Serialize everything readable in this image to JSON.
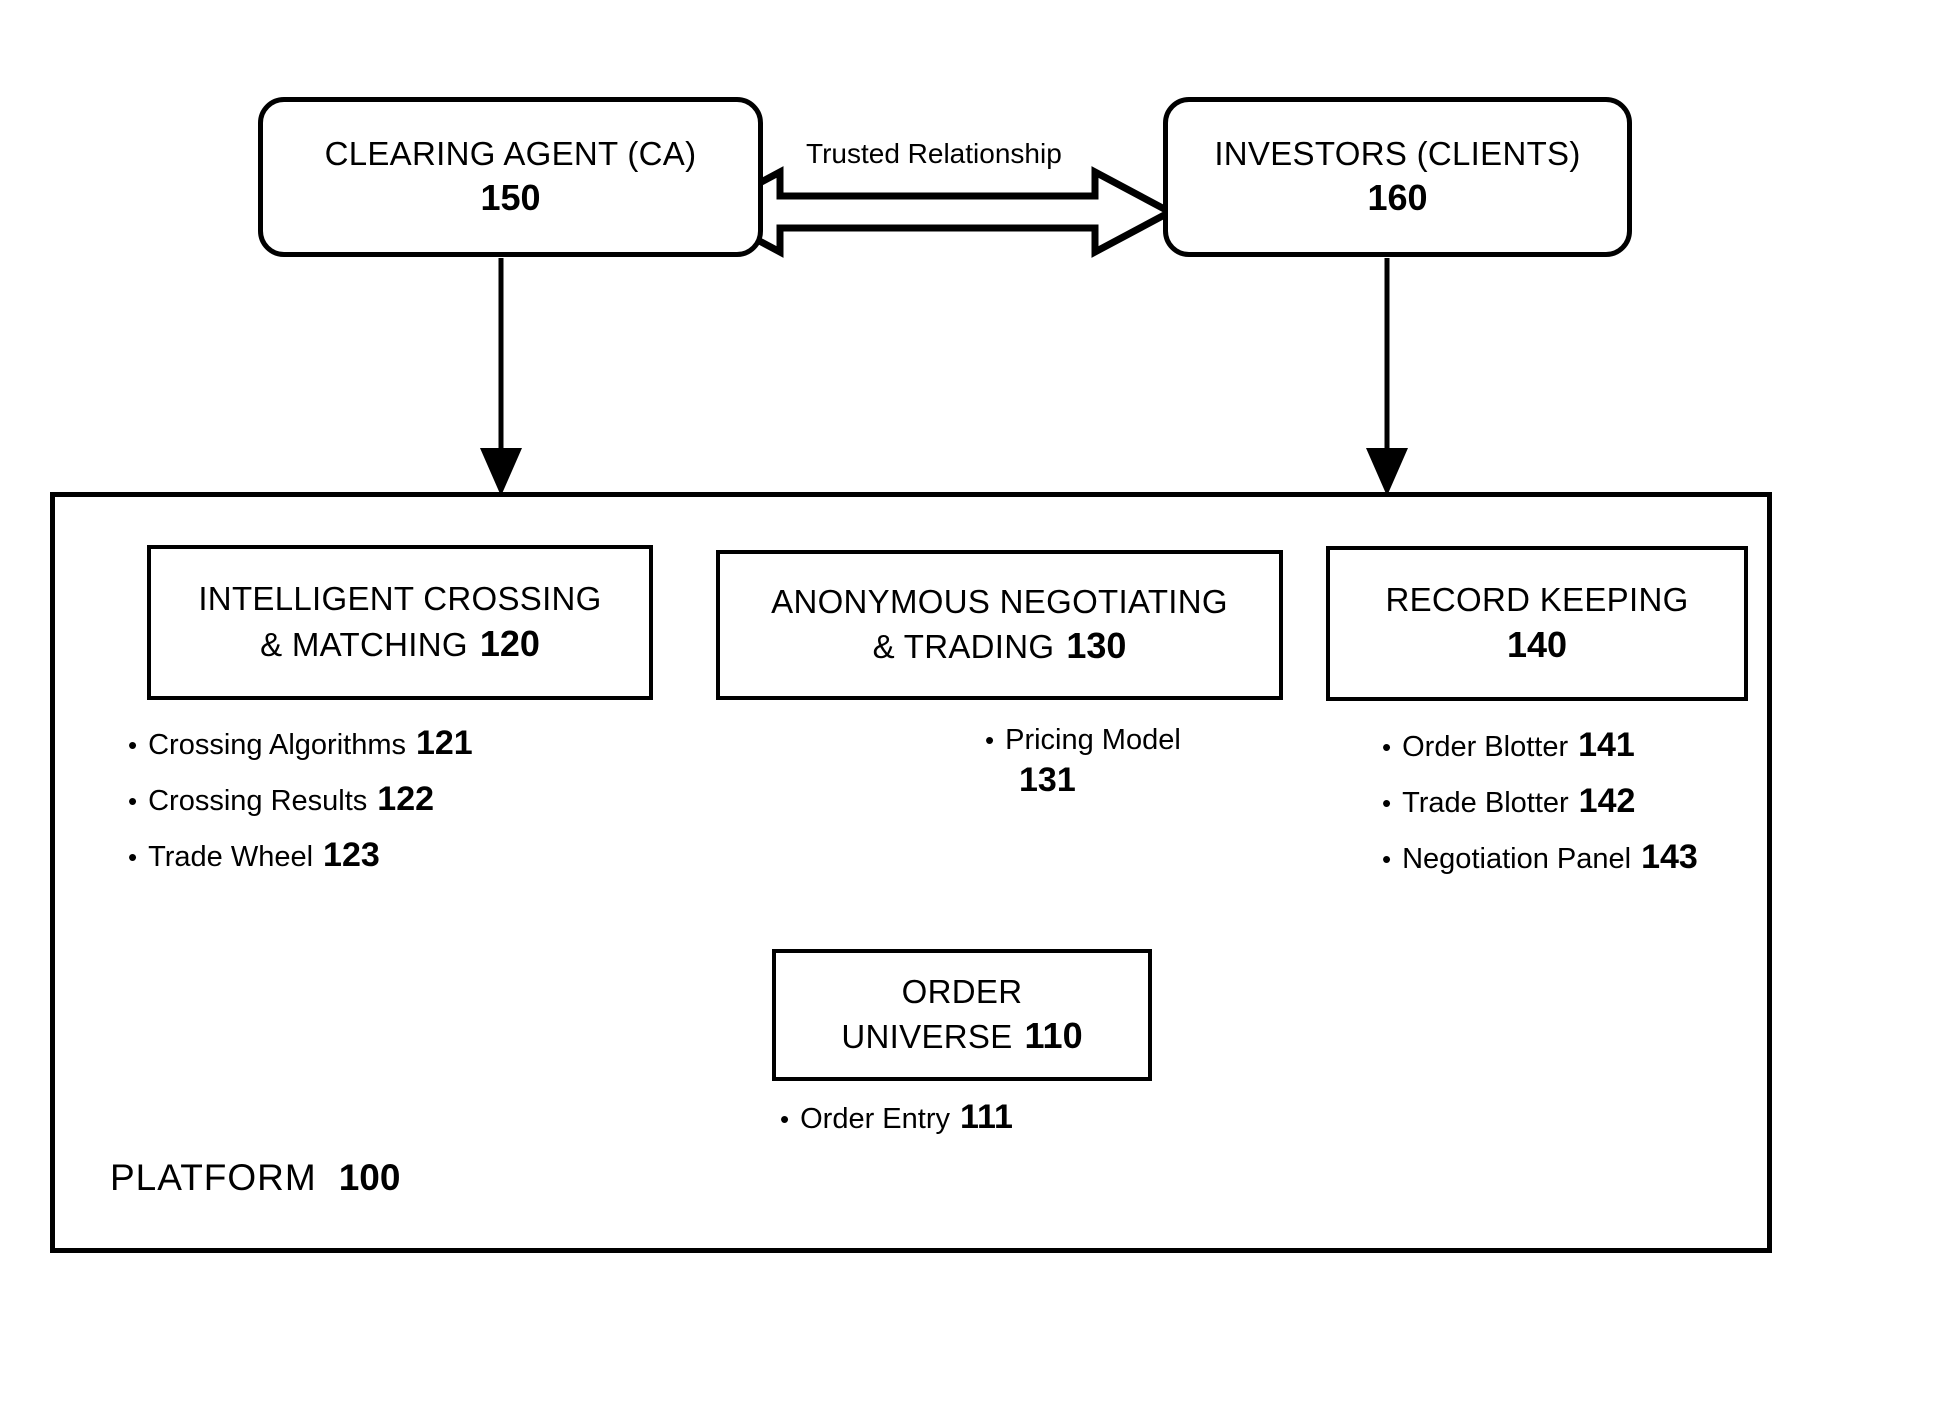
{
  "figure": {
    "top_boxes": [
      {
        "id": "clearing-agent",
        "title": "CLEARING AGENT (CA)",
        "number": "150"
      },
      {
        "id": "investors",
        "title": "INVESTORS (CLIENTS)",
        "number": "160"
      }
    ],
    "relationship_label": "Trusted Relationship",
    "platform": {
      "label": "PLATFORM",
      "number": "100",
      "modules": [
        {
          "id": "intelligent-crossing-matching",
          "line1": "INTELLIGENT CROSSING",
          "line2": "& MATCHING",
          "number": "120",
          "items": [
            {
              "text": "Crossing Algorithms",
              "number": "121"
            },
            {
              "text": "Crossing Results",
              "number": "122"
            },
            {
              "text": "Trade Wheel",
              "number": "123"
            }
          ]
        },
        {
          "id": "anonymous-negotiating-trading",
          "line1": "ANONYMOUS NEGOTIATING",
          "line2": "& TRADING",
          "number": "130",
          "items": [
            {
              "text": "Pricing Model",
              "number": "131"
            }
          ]
        },
        {
          "id": "record-keeping",
          "line1": "RECORD KEEPING",
          "line2": "",
          "number": "140",
          "items": [
            {
              "text": "Order Blotter",
              "number": "141"
            },
            {
              "text": "Trade Blotter",
              "number": "142"
            },
            {
              "text": "Negotiation Panel",
              "number": "143"
            }
          ]
        }
      ],
      "order_universe": {
        "id": "order-universe",
        "line1": "ORDER",
        "line2": "UNIVERSE",
        "number": "110",
        "items": [
          {
            "text": "Order Entry",
            "number": "111"
          }
        ]
      }
    },
    "bullet_glyph": "•",
    "colors": {
      "stroke": "#000000",
      "background": "#ffffff"
    }
  }
}
